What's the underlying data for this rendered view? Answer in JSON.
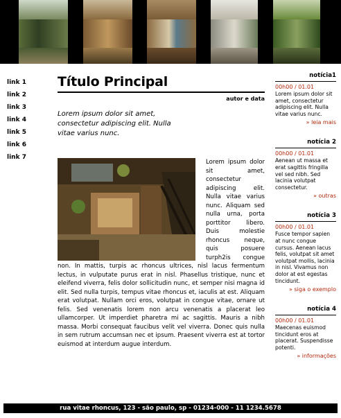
{
  "header": {
    "photos": [
      "patio-photo-1",
      "interior-photo-2",
      "sculpture-photo-3",
      "alley-photo-4",
      "garden-photo-5"
    ]
  },
  "nav": [
    "link 1",
    "link 2",
    "link 3",
    "link 4",
    "link 5",
    "link 6",
    "link 7"
  ],
  "article": {
    "title": "Título Principal",
    "author": "autor e data",
    "lead": "Lorem ipsum dolor sit amet, consectetur adipiscing elit. Nulla vitae varius nunc.",
    "body": "Lorem ipsum dolor sit amet, consectetur adipiscing elit. Nulla vitae varius nunc. Aliquam sed nulla urna, porta porttitor libero. Duis molestie rhoncus neque, quis posuere turph2is congue non. In mattis, turpis ac rhoncus ultrices, nisl lacus fermentum lectus, in vulputate purus erat in nisl. Phasellus tristique, nunc et eleifend viverra, felis dolor sollicitudin nunc, et semper nisi magna id elit. Sed nulla turpis, tempus vitae rhoncus et, iaculis at est. Aliquam erat volutpat. Nullam orci eros, volutpat in congue vitae, ornare ut felis. Sed venenatis lorem non arcu venenatis a placerat leo ullamcorper. Ut imperdiet pharetra mi ac sagittis. Mauris a nibh massa. Morbi consequat faucibus velit vel viverra. Donec quis nulla in sem rutrum accumsan nec et ipsum. Praesent viverra est at tortor euismod at interdum augue interdum."
  },
  "news": [
    {
      "title": "notícia1",
      "date": "00h00 / 01.01",
      "text": "Lorem ipsum dolor sit amet, consectetur adipiscing elit. Nulla vitae varius nunc.",
      "more": "» leia mais"
    },
    {
      "title": "notícia 2",
      "date": "00h00 / 01.01",
      "text": "Aenean ut massa et erat sagittis fringilla vel sed nibh. Sed lacinia volutpat consectetur.",
      "more": "» outras"
    },
    {
      "title": "notícia 3",
      "date": "00h00 / 01.01",
      "text": "Fusce tempor sapien at nunc congue cursus. Aenean lacus felis, volutpat sit amet volutpat mollis, lacinia in nisl. Vivamus non dolor at est egestas tincidunt.",
      "more": "» siga o exemplo"
    },
    {
      "title": "notícia 4",
      "date": "00h00 / 01.01",
      "text": "Maecenas euismod tincidunt eros at placerat. Suspendisse potenti.",
      "more": "» informações"
    }
  ],
  "footer": "rua vitae rhoncus, 123 - são paulo, sp - 01234-000 - 11 1234.5678"
}
